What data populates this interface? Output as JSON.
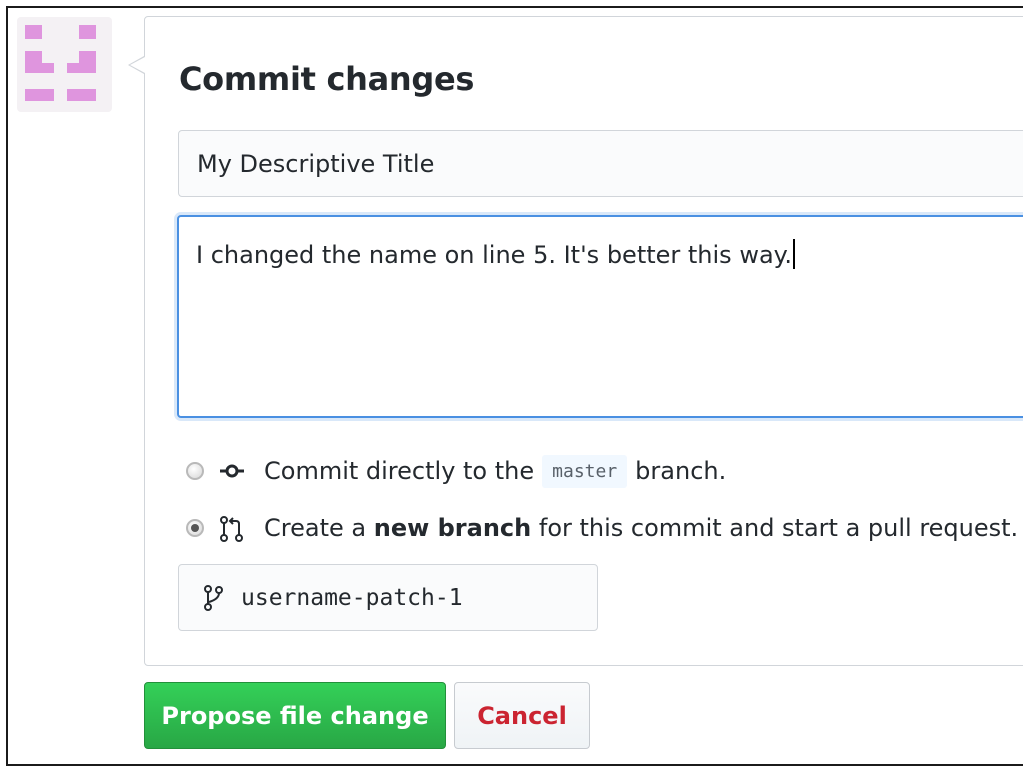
{
  "commit": {
    "heading": "Commit changes",
    "title_value": "My Descriptive Title",
    "description_value": "I changed the name on line 5. It's better this way.",
    "options": [
      {
        "label_before": "Commit directly to the",
        "branch_code": "master",
        "label_after": "branch.",
        "icon": "git-commit-icon",
        "selected": false
      },
      {
        "label_before": "Create a",
        "label_bold": "new branch",
        "label_after": "for this commit and start a pull request.",
        "icon": "git-pull-request-icon",
        "selected": true
      }
    ],
    "branch_name": "username-patch-1",
    "branch_icon": "git-branch-icon"
  },
  "buttons": {
    "propose_label": "Propose file change",
    "cancel_label": "Cancel"
  },
  "colors": {
    "primary_green": "#28a745",
    "cancel_red": "#cb2431",
    "focus_blue": "#4a90e2",
    "avatar_pink": "#df95de"
  }
}
